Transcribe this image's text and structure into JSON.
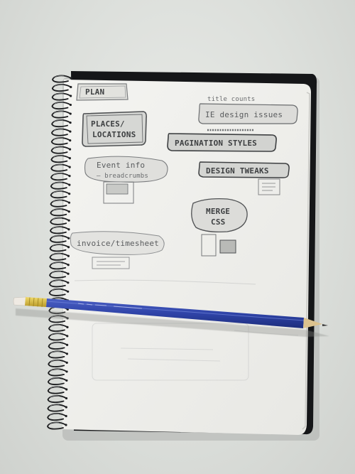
{
  "notes": {
    "plan": "PLAN",
    "places_line1": "PLACES/",
    "places_line2": "LOCATIONS",
    "title_counts": "title counts",
    "ie_design": "IE design issues",
    "pagination": "PAGINATION STYLES",
    "event_info_line1": "Event info",
    "event_info_line2": "— breadcrumbs",
    "design_tweaks": "DESIGN TWEAKS",
    "merge": "MERGE",
    "css": "CSS",
    "invoice": "invoice/timesheet"
  }
}
